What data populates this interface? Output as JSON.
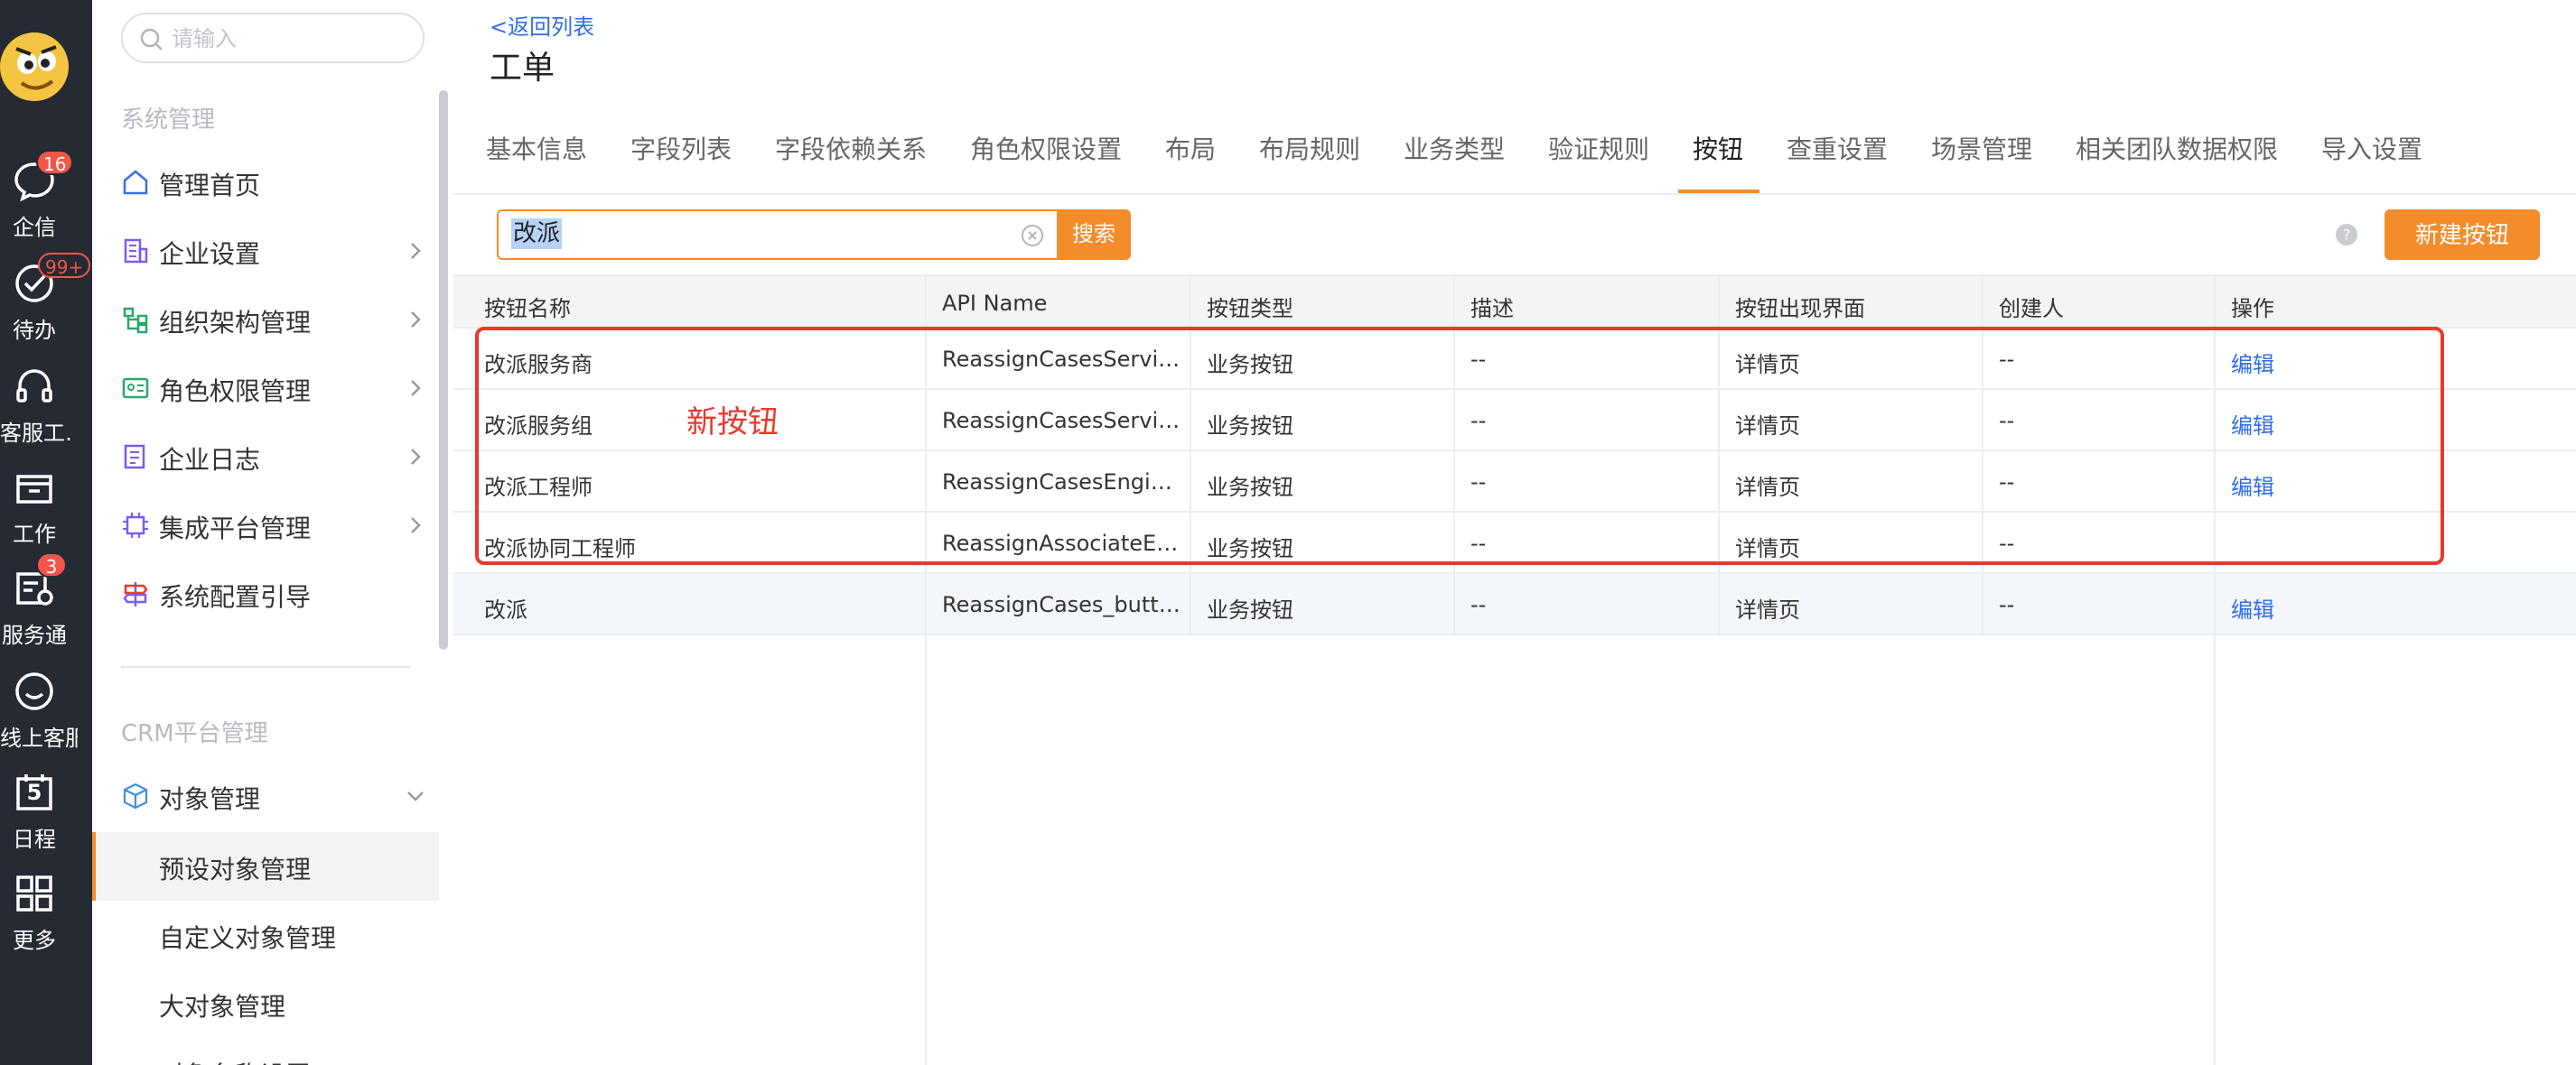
{
  "rail": {
    "items": [
      {
        "label": "企信",
        "icon": "chat-bubble-icon",
        "badge": "16"
      },
      {
        "label": "待办",
        "icon": "check-circle-icon",
        "badge": "99+"
      },
      {
        "label": "客服工…",
        "icon": "headset-icon",
        "badge": ""
      },
      {
        "label": "工作",
        "icon": "briefcase-icon",
        "badge": ""
      },
      {
        "label": "服务通",
        "icon": "service-icon",
        "badge": "3"
      },
      {
        "label": "线上客服",
        "icon": "smile-chat-icon",
        "badge": ""
      },
      {
        "label": "日程",
        "icon": "calendar-icon",
        "badge": "",
        "day": "5"
      },
      {
        "label": "更多",
        "icon": "grid-icon",
        "badge": ""
      }
    ]
  },
  "sidebar": {
    "search_placeholder": "请输入",
    "section1": "系统管理",
    "items": [
      {
        "label": "管理首页",
        "icon": "home-icon",
        "arrow": false
      },
      {
        "label": "企业设置",
        "icon": "building-icon",
        "arrow": true
      },
      {
        "label": "组织架构管理",
        "icon": "org-tree-icon",
        "arrow": true
      },
      {
        "label": "角色权限管理",
        "icon": "id-card-icon",
        "arrow": true
      },
      {
        "label": "企业日志",
        "icon": "log-icon",
        "arrow": true
      },
      {
        "label": "集成平台管理",
        "icon": "chip-icon",
        "arrow": true
      },
      {
        "label": "系统配置引导",
        "icon": "signpost-icon",
        "arrow": false
      }
    ],
    "section2": "CRM平台管理",
    "object_mgmt": {
      "label": "对象管理",
      "icon": "cube-icon"
    },
    "sub_items": [
      {
        "label": "预设对象管理",
        "active": true
      },
      {
        "label": "自定义对象管理",
        "active": false
      },
      {
        "label": "大对象管理",
        "active": false
      },
      {
        "label": "对象名称设置",
        "active": false
      }
    ]
  },
  "header": {
    "back_link": "<返回列表",
    "title": "工单"
  },
  "tabs": [
    {
      "label": "基本信息",
      "active": false
    },
    {
      "label": "字段列表",
      "active": false
    },
    {
      "label": "字段依赖关系",
      "active": false
    },
    {
      "label": "角色权限设置",
      "active": false
    },
    {
      "label": "布局",
      "active": false
    },
    {
      "label": "布局规则",
      "active": false
    },
    {
      "label": "业务类型",
      "active": false
    },
    {
      "label": "验证规则",
      "active": false
    },
    {
      "label": "按钮",
      "active": true
    },
    {
      "label": "查重设置",
      "active": false
    },
    {
      "label": "场景管理",
      "active": false
    },
    {
      "label": "相关团队数据权限",
      "active": false
    },
    {
      "label": "导入设置",
      "active": false
    }
  ],
  "toolbar": {
    "search_value": "改派",
    "search_button": "搜索",
    "new_button": "新建按钮"
  },
  "table": {
    "columns": [
      "按钮名称",
      "API Name",
      "按钮类型",
      "描述",
      "按钮出现界面",
      "创建人",
      "操作"
    ],
    "rows": [
      {
        "name": "改派服务商",
        "api": "ReassignCasesServi…",
        "type": "业务按钮",
        "desc": "--",
        "ui": "详情页",
        "creator": "--",
        "action": "编辑"
      },
      {
        "name": "改派服务组",
        "api": "ReassignCasesServi…",
        "type": "业务按钮",
        "desc": "--",
        "ui": "详情页",
        "creator": "--",
        "action": "编辑"
      },
      {
        "name": "改派工程师",
        "api": "ReassignCasesEngin…",
        "type": "业务按钮",
        "desc": "--",
        "ui": "详情页",
        "creator": "--",
        "action": "编辑"
      },
      {
        "name": "改派协同工程师",
        "api": "ReassignAssociateE…",
        "type": "业务按钮",
        "desc": "--",
        "ui": "详情页",
        "creator": "--",
        "action": ""
      },
      {
        "name": "改派",
        "api": "ReassignCases_butt…",
        "type": "业务按钮",
        "desc": "--",
        "ui": "详情页",
        "creator": "--",
        "action": "编辑"
      }
    ]
  },
  "annotation": "新按钮",
  "colors": {
    "accent": "#f58c2c",
    "link": "#2f6ee8",
    "annotation": "#e8392b",
    "rail_bg": "#252a33"
  }
}
